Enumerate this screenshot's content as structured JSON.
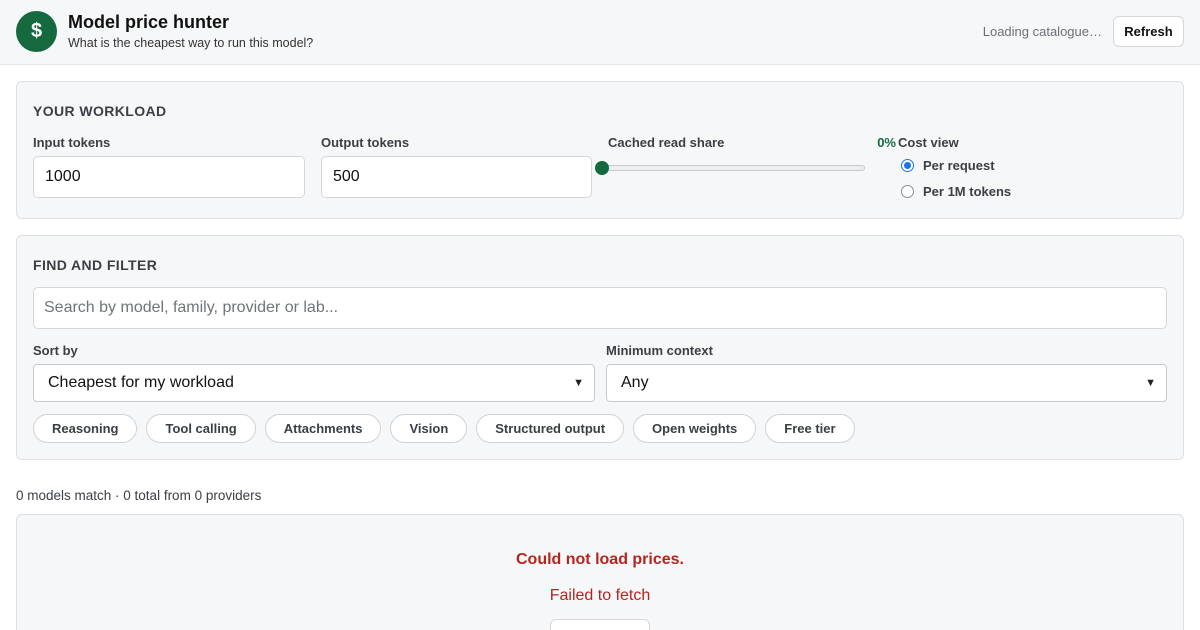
{
  "header": {
    "logo_glyph": "$",
    "title": "Model price hunter",
    "subtitle": "What is the cheapest way to run this model?",
    "status": "Loading catalogue…",
    "refresh_label": "Refresh"
  },
  "workload": {
    "title": "YOUR WORKLOAD",
    "input_tokens_label": "Input tokens",
    "input_tokens_value": "1000",
    "output_tokens_label": "Output tokens",
    "output_tokens_value": "500",
    "cached_label": "Cached read share",
    "cached_value_text": "0%",
    "cached_value": 0,
    "cost_view_label": "Cost view",
    "cost_view_options": [
      {
        "label": "Per request",
        "selected": true
      },
      {
        "label": "Per 1M tokens",
        "selected": false
      }
    ]
  },
  "filter": {
    "title": "FIND AND FILTER",
    "search_placeholder": "Search by model, family, provider or lab...",
    "sort_label": "Sort by",
    "sort_value": "Cheapest for my workload",
    "min_context_label": "Minimum context",
    "min_context_value": "Any",
    "chips": [
      "Reasoning",
      "Tool calling",
      "Attachments",
      "Vision",
      "Structured output",
      "Open weights",
      "Free tier"
    ]
  },
  "results": {
    "summary": "0 models match · 0 total from 0 providers",
    "error_title": "Could not load prices.",
    "error_detail": "Failed to fetch"
  },
  "colors": {
    "brand": "#15693f",
    "error": "#b3261e",
    "radio_accent": "#1a73e8"
  }
}
